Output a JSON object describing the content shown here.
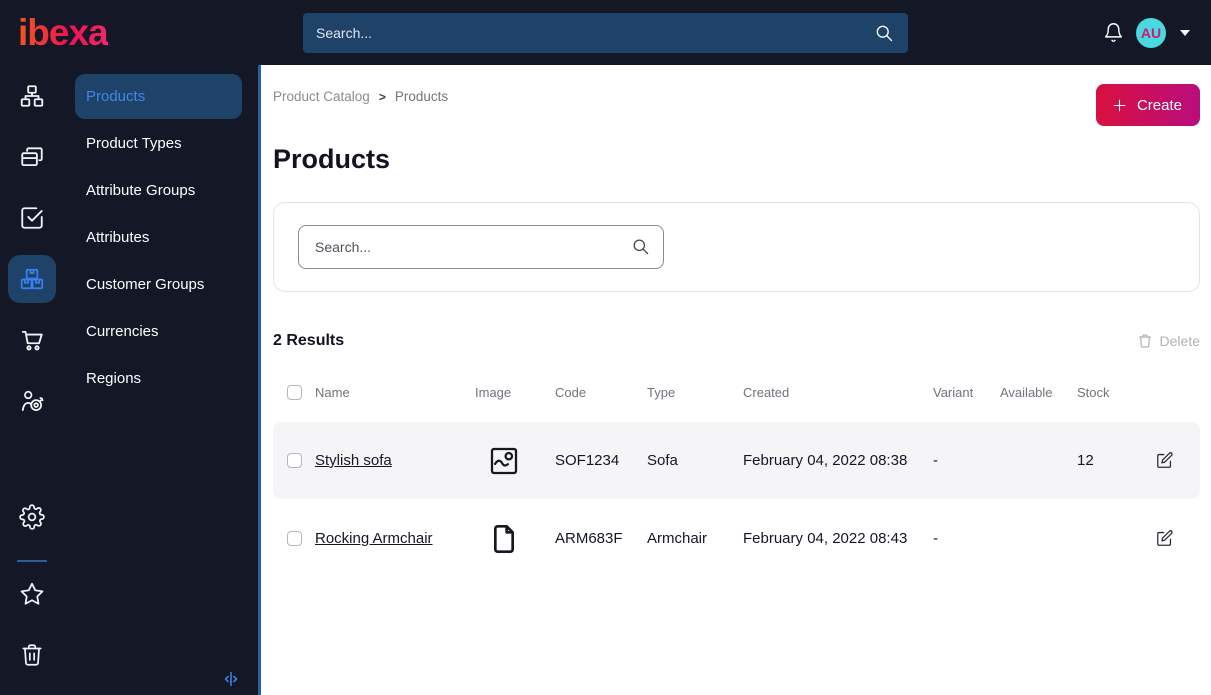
{
  "topbar": {
    "logo": "ibexa",
    "search_placeholder": "Search...",
    "avatar_initials": "AU"
  },
  "icon_rail": {
    "items": [
      {
        "icon": "sitemap-icon",
        "active": false
      },
      {
        "icon": "pages-icon",
        "active": false
      },
      {
        "icon": "tasks-icon",
        "active": false
      },
      {
        "icon": "product-boxes-icon",
        "active": true
      },
      {
        "icon": "cart-icon",
        "active": false
      },
      {
        "icon": "customer-target-icon",
        "active": false
      }
    ],
    "bottom_items": [
      {
        "icon": "gear-icon"
      },
      {
        "icon": "star-icon"
      },
      {
        "icon": "trash-icon"
      }
    ]
  },
  "sidebar": {
    "items": [
      {
        "label": "Products",
        "active": true
      },
      {
        "label": "Product Types",
        "active": false
      },
      {
        "label": "Attribute Groups",
        "active": false
      },
      {
        "label": "Attributes",
        "active": false
      },
      {
        "label": "Customer Groups",
        "active": false
      },
      {
        "label": "Currencies",
        "active": false
      },
      {
        "label": "Regions",
        "active": false
      }
    ]
  },
  "breadcrumb": {
    "items": [
      "Product Catalog",
      "Products"
    ],
    "separator": ">"
  },
  "header": {
    "title": "Products",
    "create_label": "Create"
  },
  "filter": {
    "search_placeholder": "Search..."
  },
  "results": {
    "count_label": "2 Results",
    "delete_label": "Delete"
  },
  "table": {
    "columns": [
      "Name",
      "Image",
      "Code",
      "Type",
      "Created",
      "Variant",
      "Available",
      "Stock"
    ],
    "rows": [
      {
        "name": "Stylish sofa",
        "image_icon": "image-icon",
        "code": "SOF1234",
        "type": "Sofa",
        "created": "February 04, 2022 08:38",
        "variant": "-",
        "available": true,
        "stock": "12"
      },
      {
        "name": "Rocking Armchair",
        "image_icon": "file-icon",
        "code": "ARM683F",
        "type": "Armchair",
        "created": "February 04, 2022 08:43",
        "variant": "-",
        "available": false,
        "stock": ""
      }
    ]
  },
  "colors": {
    "topbar_bg": "#131726",
    "topbar_search_bg": "#1f4368",
    "sidebar_border_blue": "#2b5e9c",
    "active_item_bg": "#1f4368",
    "accent_blue": "#4285ec",
    "rail_active_icon": "#3b7ff0",
    "logo_gradient_start": "#f4581d",
    "logo_gradient_end": "#ee1350",
    "create_gradient_start": "#d9103f",
    "create_gradient_end": "#b90d7e",
    "avatar_bg": "#49d9e0",
    "avatar_text": "#d5186f",
    "available_dot": "#189e2a",
    "unavailable_dot": "#b1b1b6",
    "row_highlight_bg": "#f5f5f8"
  }
}
